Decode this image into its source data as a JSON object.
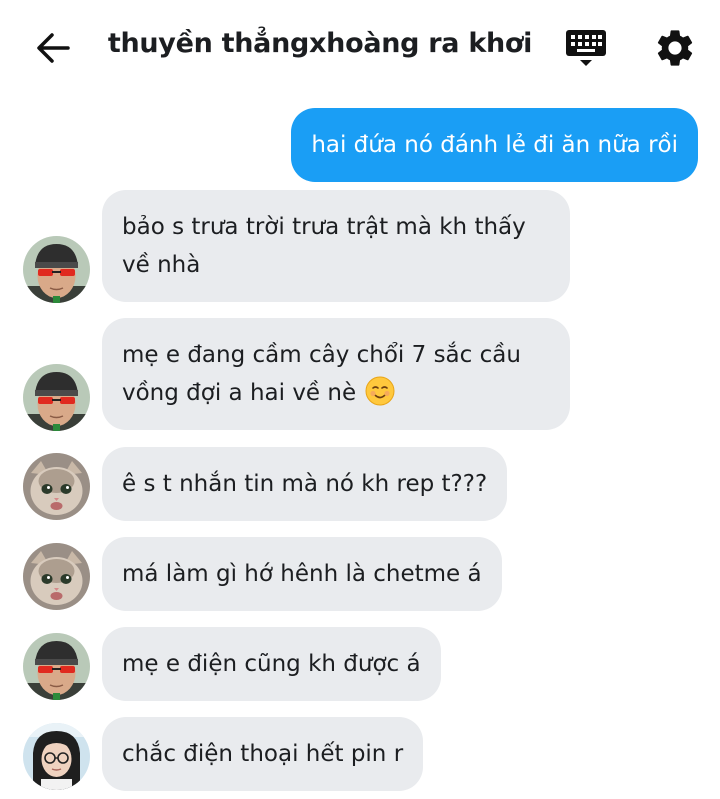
{
  "header": {
    "title": "thuyền thẳngxhoàng ra khơi",
    "back_icon": "arrow-left-icon",
    "keyboard_icon": "keyboard-icon",
    "settings_icon": "gear-icon"
  },
  "colors": {
    "outgoing_bubble": "#1a9ef5",
    "incoming_bubble": "#e9ebee"
  },
  "messages": [
    {
      "sender": "me",
      "text": "hai đứa nó đánh lẻ đi ăn nữa rồi"
    },
    {
      "sender": "red-glasses-user",
      "text": "bảo s trưa trời trưa trật mà kh thấy về nhà"
    },
    {
      "sender": "red-glasses-user",
      "text": "mẹ e đang cầm cây chổi 7 sắc cầu vồng đợi a hai về nè",
      "emoji": "smiling-face-icon"
    },
    {
      "sender": "cat-user",
      "text": "ê s t nhắn tin mà nó kh rep t???"
    },
    {
      "sender": "cat-user",
      "text": "má làm gì hớ hênh là chetme á"
    },
    {
      "sender": "red-glasses-user",
      "text": "mẹ e điện cũng kh được á"
    },
    {
      "sender": "glasses-girl-user",
      "text": "chắc điện thoại hết pin r"
    }
  ]
}
